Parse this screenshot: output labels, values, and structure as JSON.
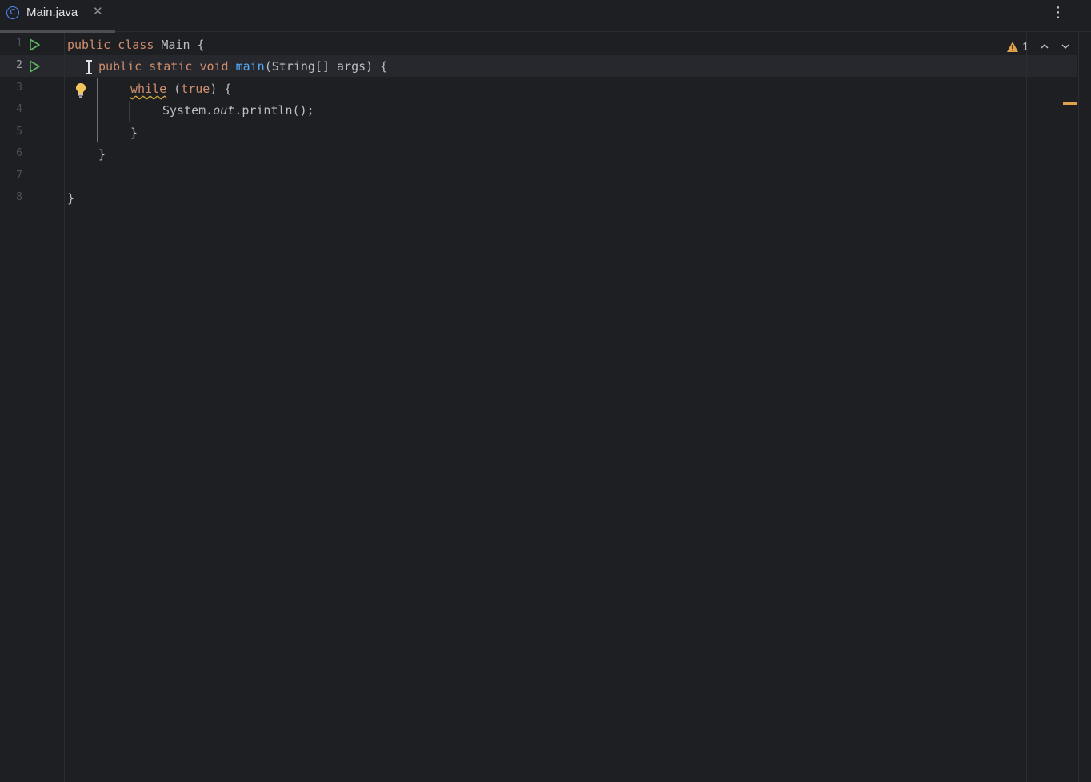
{
  "tabs": [
    {
      "label": "Main.java",
      "icon": "class-icon",
      "active": true
    }
  ],
  "editor": {
    "lines": [
      {
        "number": "1",
        "has_run": true
      },
      {
        "number": "2",
        "has_run": true
      },
      {
        "number": "3"
      },
      {
        "number": "4"
      },
      {
        "number": "5"
      },
      {
        "number": "6"
      },
      {
        "number": "7"
      },
      {
        "number": "8"
      }
    ],
    "code": {
      "l1": {
        "kw1": "public",
        "kw2": "class",
        "rest": " Main {"
      },
      "l2": {
        "kw1": "public",
        "kw2": "static",
        "kw3": "void",
        "fn": "main",
        "rest": "(String[] args) {"
      },
      "l3": {
        "kw1": "while",
        "paren_open": " (",
        "kw2": "true",
        "rest": ") {"
      },
      "l4": {
        "prefix": "System.",
        "field": "out",
        "rest": ".println();"
      },
      "l5": {
        "text": "}"
      },
      "l6": {
        "text": "}"
      },
      "l8": {
        "text": "}"
      }
    },
    "current_line": "2"
  },
  "inspections": {
    "warning_count": "1",
    "warning_color": "#e0a14a"
  },
  "colors": {
    "background": "#1e1f22",
    "keyword": "#cf8e6d",
    "function": "#56a8f5",
    "text": "#bcbec4",
    "run_icon": "#5fb865"
  }
}
